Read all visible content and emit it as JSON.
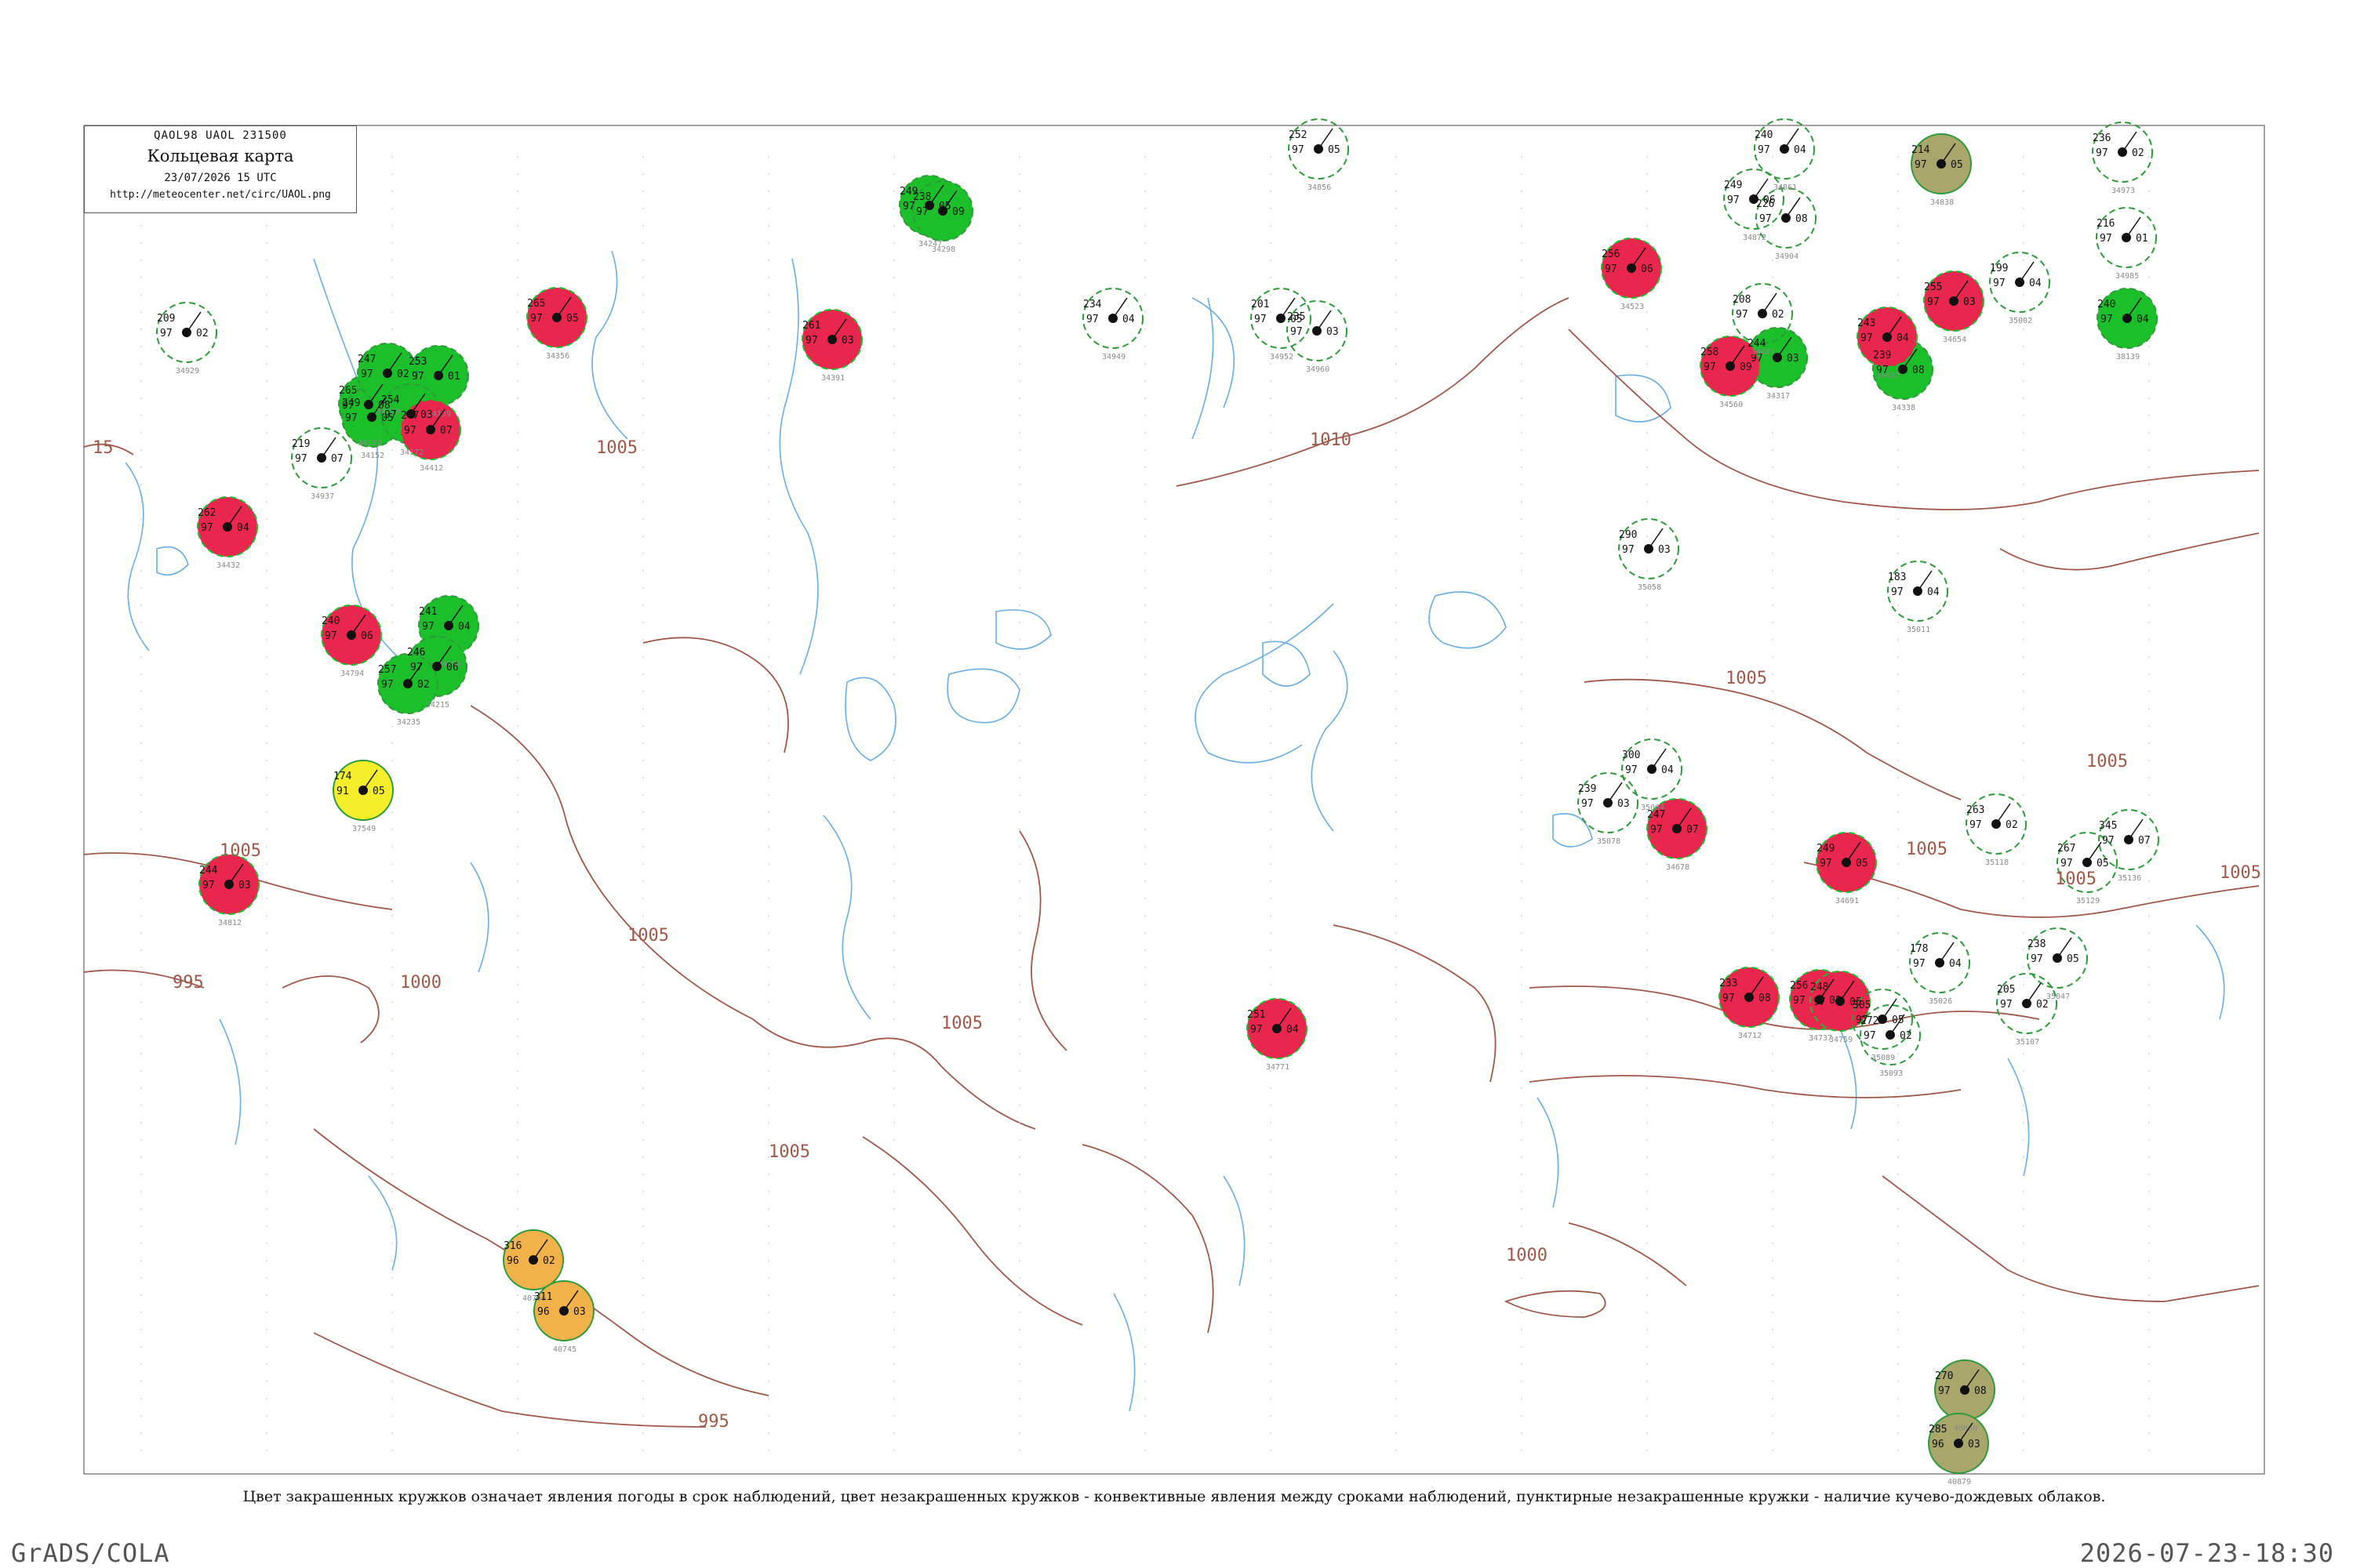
{
  "header": {
    "code": "QAOL98  UAOL  231500",
    "title": "Кольцевая карта",
    "date": "23/07/2026 15 UTC",
    "url": "http://meteocenter.net/circ/UAOL.png"
  },
  "isobars": [
    {
      "label": "1010"
    },
    {
      "label": "1005"
    },
    {
      "label": "1005"
    },
    {
      "label": "1005"
    },
    {
      "label": "1005"
    },
    {
      "label": "1005"
    },
    {
      "label": "1005"
    },
    {
      "label": "1005"
    },
    {
      "label": "1005"
    },
    {
      "label": "1005"
    },
    {
      "label": "1000"
    },
    {
      "label": "1000"
    },
    {
      "label": "995"
    },
    {
      "label": "995"
    },
    {
      "label": "1005"
    },
    {
      "label": "15"
    }
  ],
  "legend": {
    "caption": "Цвет закрашенных кружков означает явления погоды в срок наблюдений, цвет незакрашенных кружков - конвективные явления между сроками наблюдений, пунктирные незакрашенные кружки - наличие кучево-дождевых облаков.",
    "colors": {
      "rain": "#1bbf2a",
      "thunderstorm": "#e8264e",
      "fog_haze": "#a9a66b",
      "dust": "#f2b24a",
      "mist": "#f5ee2a",
      "cumulonimbus": "#2e9a3a",
      "isobar": "#a0584a",
      "water": "#6aaee3"
    }
  },
  "stations": [
    {
      "code": "34123",
      "pressure": "265",
      "temp": "97",
      "dew": "08",
      "type": "rain"
    },
    {
      "code": "34139",
      "pressure": "253",
      "temp": "97",
      "dew": "01",
      "type": "rain"
    },
    {
      "code": "34152",
      "pressure": "249",
      "temp": "97",
      "dew": "05",
      "type": "rain"
    },
    {
      "code": "34163",
      "pressure": "247",
      "temp": "97",
      "dew": "02",
      "type": "rain"
    },
    {
      "code": "34172",
      "pressure": "254",
      "temp": "97",
      "dew": "03",
      "type": "rain"
    },
    {
      "code": "34186",
      "pressure": "241",
      "temp": "97",
      "dew": "04",
      "type": "rain"
    },
    {
      "code": "34215",
      "pressure": "246",
      "temp": "97",
      "dew": "06",
      "type": "rain"
    },
    {
      "code": "34235",
      "pressure": "257",
      "temp": "97",
      "dew": "02",
      "type": "rain"
    },
    {
      "code": "34247",
      "pressure": "249",
      "temp": "97",
      "dew": "05",
      "type": "rain"
    },
    {
      "code": "34298",
      "pressure": "238",
      "temp": "97",
      "dew": "09",
      "type": "rain"
    },
    {
      "code": "34317",
      "pressure": "244",
      "temp": "97",
      "dew": "03",
      "type": "rain"
    },
    {
      "code": "34338",
      "pressure": "239",
      "temp": "97",
      "dew": "08",
      "type": "rain"
    },
    {
      "code": "38139",
      "pressure": "240",
      "temp": "97",
      "dew": "04",
      "type": "rain"
    },
    {
      "code": "34356",
      "pressure": "265",
      "temp": "97",
      "dew": "05",
      "type": "thunderstorm"
    },
    {
      "code": "34391",
      "pressure": "261",
      "temp": "97",
      "dew": "03",
      "type": "thunderstorm"
    },
    {
      "code": "34412",
      "pressure": "247",
      "temp": "97",
      "dew": "07",
      "type": "thunderstorm"
    },
    {
      "code": "34432",
      "pressure": "262",
      "temp": "97",
      "dew": "04",
      "type": "thunderstorm"
    },
    {
      "code": "34523",
      "pressure": "256",
      "temp": "97",
      "dew": "06",
      "type": "thunderstorm"
    },
    {
      "code": "34560",
      "pressure": "258",
      "temp": "97",
      "dew": "09",
      "type": "thunderstorm"
    },
    {
      "code": "34622",
      "pressure": "243",
      "temp": "97",
      "dew": "04",
      "type": "thunderstorm"
    },
    {
      "code": "34654",
      "pressure": "255",
      "temp": "97",
      "dew": "03",
      "type": "thunderstorm"
    },
    {
      "code": "34678",
      "pressure": "247",
      "temp": "97",
      "dew": "07",
      "type": "thunderstorm"
    },
    {
      "code": "34691",
      "pressure": "249",
      "temp": "97",
      "dew": "05",
      "type": "thunderstorm"
    },
    {
      "code": "34712",
      "pressure": "233",
      "temp": "97",
      "dew": "08",
      "type": "thunderstorm"
    },
    {
      "code": "34737",
      "pressure": "256",
      "temp": "97",
      "dew": "02",
      "type": "thunderstorm"
    },
    {
      "code": "34759",
      "pressure": "248",
      "temp": "97",
      "dew": "05",
      "type": "thunderstorm"
    },
    {
      "code": "34771",
      "pressure": "251",
      "temp": "97",
      "dew": "04",
      "type": "thunderstorm"
    },
    {
      "code": "34794",
      "pressure": "240",
      "temp": "97",
      "dew": "06",
      "type": "thunderstorm"
    },
    {
      "code": "34812",
      "pressure": "244",
      "temp": "97",
      "dew": "03",
      "type": "thunderstorm"
    },
    {
      "code": "34838",
      "pressure": "214",
      "temp": "97",
      "dew": "05",
      "type": "fog_haze"
    },
    {
      "code": "40860",
      "pressure": "270",
      "temp": "97",
      "dew": "08",
      "type": "fog_haze"
    },
    {
      "code": "40879",
      "pressure": "285",
      "temp": "96",
      "dew": "03",
      "type": "fog_haze"
    },
    {
      "code": "40766",
      "pressure": "316",
      "temp": "96",
      "dew": "02",
      "type": "dust"
    },
    {
      "code": "40745",
      "pressure": "311",
      "temp": "96",
      "dew": "03",
      "type": "dust"
    },
    {
      "code": "37549",
      "pressure": "174",
      "temp": "91",
      "dew": "05",
      "type": "mist"
    },
    {
      "code": "34856",
      "pressure": "252",
      "temp": "97",
      "dew": "05",
      "type": "cb"
    },
    {
      "code": "34861",
      "pressure": "240",
      "temp": "97",
      "dew": "04",
      "type": "cb"
    },
    {
      "code": "34872",
      "pressure": "249",
      "temp": "97",
      "dew": "06",
      "type": "cb"
    },
    {
      "code": "34887",
      "pressure": "208",
      "temp": "97",
      "dew": "02",
      "type": "cb"
    },
    {
      "code": "34904",
      "pressure": "226",
      "temp": "97",
      "dew": "08",
      "type": "cb"
    },
    {
      "code": "34929",
      "pressure": "209",
      "temp": "97",
      "dew": "02",
      "type": "cb"
    },
    {
      "code": "34937",
      "pressure": "219",
      "temp": "97",
      "dew": "07",
      "type": "cb"
    },
    {
      "code": "34949",
      "pressure": "234",
      "temp": "97",
      "dew": "04",
      "type": "cb"
    },
    {
      "code": "34952",
      "pressure": "201",
      "temp": "97",
      "dew": "05",
      "type": "cb"
    },
    {
      "code": "34960",
      "pressure": "235",
      "temp": "97",
      "dew": "03",
      "type": "cb"
    },
    {
      "code": "34973",
      "pressure": "236",
      "temp": "97",
      "dew": "02",
      "type": "cb"
    },
    {
      "code": "34985",
      "pressure": "216",
      "temp": "97",
      "dew": "01",
      "type": "cb"
    },
    {
      "code": "35002",
      "pressure": "199",
      "temp": "97",
      "dew": "04",
      "type": "cb"
    },
    {
      "code": "35011",
      "pressure": "183",
      "temp": "97",
      "dew": "04",
      "type": "cb"
    },
    {
      "code": "35026",
      "pressure": "178",
      "temp": "97",
      "dew": "04",
      "type": "cb"
    },
    {
      "code": "35047",
      "pressure": "238",
      "temp": "97",
      "dew": "05",
      "type": "cb"
    },
    {
      "code": "35058",
      "pressure": "290",
      "temp": "97",
      "dew": "03",
      "type": "cb"
    },
    {
      "code": "35064",
      "pressure": "300",
      "temp": "97",
      "dew": "04",
      "type": "cb"
    },
    {
      "code": "35078",
      "pressure": "239",
      "temp": "97",
      "dew": "03",
      "type": "cb"
    },
    {
      "code": "35089",
      "pressure": "305",
      "temp": "97",
      "dew": "05",
      "type": "cb"
    },
    {
      "code": "35093",
      "pressure": "272",
      "temp": "97",
      "dew": "02",
      "type": "cb"
    },
    {
      "code": "35107",
      "pressure": "205",
      "temp": "97",
      "dew": "02",
      "type": "cb"
    },
    {
      "code": "35118",
      "pressure": "263",
      "temp": "97",
      "dew": "02",
      "type": "cb"
    },
    {
      "code": "35129",
      "pressure": "267",
      "temp": "97",
      "dew": "05",
      "type": "cb"
    },
    {
      "code": "35136",
      "pressure": "345",
      "temp": "97",
      "dew": "07",
      "type": "cb"
    }
  ],
  "footer": {
    "left": "GrADS/COLA",
    "right": "2026-07-23-18:30"
  }
}
